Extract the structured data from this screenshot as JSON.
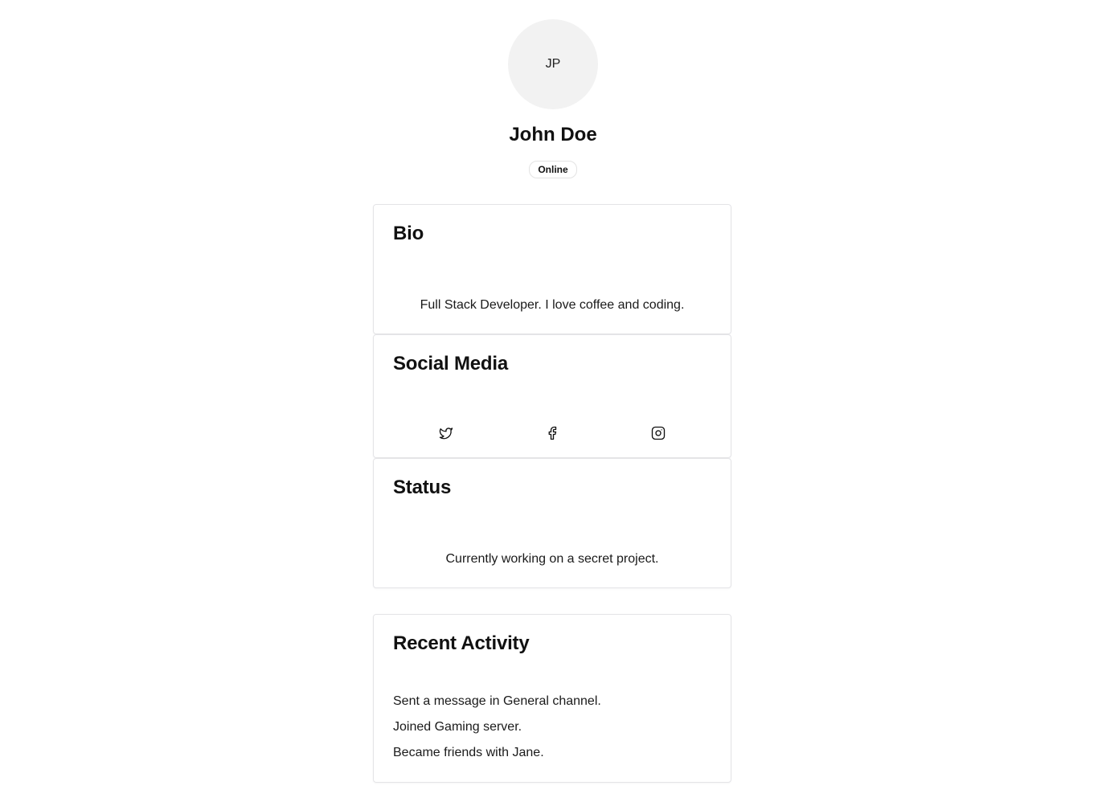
{
  "profile": {
    "initials": "JP",
    "name": "John Doe",
    "status_badge": "Online"
  },
  "bio": {
    "title": "Bio",
    "text": "Full Stack Developer. I love coffee and coding."
  },
  "social": {
    "title": "Social Media",
    "icons": [
      "twitter-icon",
      "facebook-icon",
      "instagram-icon"
    ]
  },
  "status": {
    "title": "Status",
    "text": "Currently working on a secret project."
  },
  "activity": {
    "title": "Recent Activity",
    "items": [
      "Sent a message in General channel.",
      "Joined Gaming server.",
      "Became friends with Jane."
    ]
  }
}
